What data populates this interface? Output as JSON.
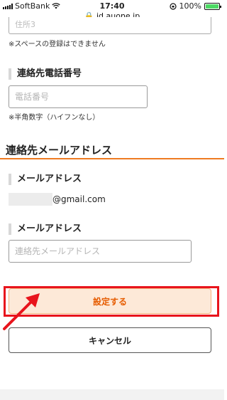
{
  "status_bar": {
    "carrier": "SoftBank",
    "time": "17:40",
    "battery_percent": "100%",
    "battery_level": 1.0
  },
  "url": "id.auone.jp",
  "previous_field": {
    "placeholder": "住所3",
    "note": "※スペースの登録はできません"
  },
  "phone_field": {
    "label": "連絡先電話番号",
    "placeholder": "電話番号",
    "note": "※半角数字（ハイフンなし）"
  },
  "section": {
    "title": "連絡先メールアドレス"
  },
  "current_email": {
    "label": "メールアドレス",
    "value_suffix": "@gmail.com"
  },
  "new_email": {
    "label": "メールアドレス",
    "placeholder": "連絡先メールアドレス"
  },
  "buttons": {
    "submit": "設定する",
    "cancel": "キャンセル"
  },
  "colors": {
    "accent": "#ee7b22",
    "submit_text": "#e65c00",
    "submit_bg": "#fde9d8",
    "annotation_red": "#e8141c"
  }
}
